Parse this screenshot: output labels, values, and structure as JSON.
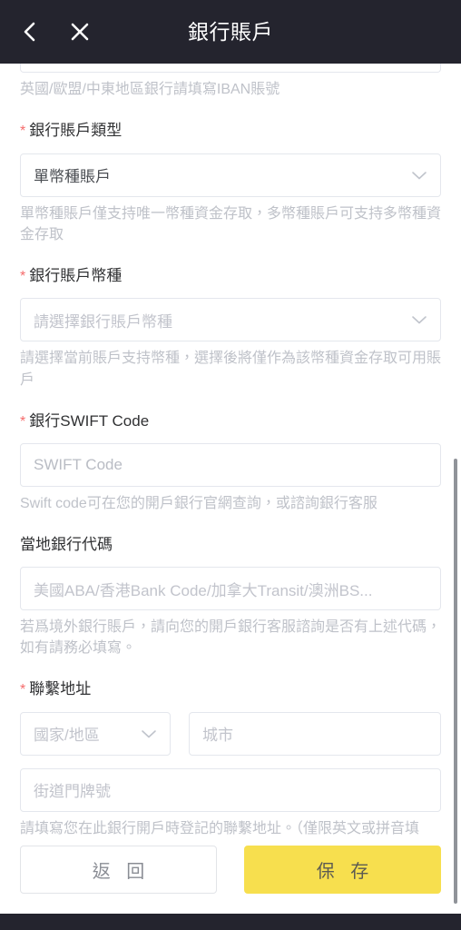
{
  "header": {
    "title": "銀行賬戶",
    "back_icon": "chevron-left-icon",
    "close_icon": "close-icon"
  },
  "form": {
    "iban_hint": "英國/歐盟/中東地區銀行請填寫IBAN賬號",
    "account_type": {
      "label": "銀行賬戶類型",
      "required": true,
      "value": "單幣種賬戶",
      "hint": "單幣種賬戶僅支持唯一幣種資金存取，多幣種賬戶可支持多幣種資金存取"
    },
    "account_currency": {
      "label": "銀行賬戶幣種",
      "required": true,
      "placeholder": "請選擇銀行賬戶幣種",
      "hint": "請選擇當前賬戶支持幣種，選擇後將僅作為該幣種資金存取可用賬戶"
    },
    "swift_code": {
      "label": "銀行SWIFT Code",
      "required": true,
      "placeholder": "SWIFT Code",
      "hint": "Swift code可在您的開戶銀行官網查詢，或諮詢銀行客服"
    },
    "local_bank_code": {
      "label": "當地銀行代碼",
      "required": false,
      "placeholder": "美國ABA/香港Bank Code/加拿大Transit/澳洲BS...",
      "hint": "若爲境外銀行賬戶，請向您的開戶銀行客服諮詢是否有上述代碼，如有請務必填寫。"
    },
    "contact_address": {
      "label": "聯繫地址",
      "required": true,
      "country_placeholder": "國家/地區",
      "city_placeholder": "城市",
      "street_placeholder": "街道門牌號",
      "hint": "請填寫您在此銀行開戶時登記的聯繫地址。（僅限英文或拼音填寫）"
    }
  },
  "actions": {
    "back_label": "返 回",
    "save_label": "保 存"
  },
  "colors": {
    "header_bg": "#24242e",
    "primary_yellow": "#f7df4e",
    "required_red": "#f56c6c",
    "hint_gray": "#bfc2c9"
  }
}
